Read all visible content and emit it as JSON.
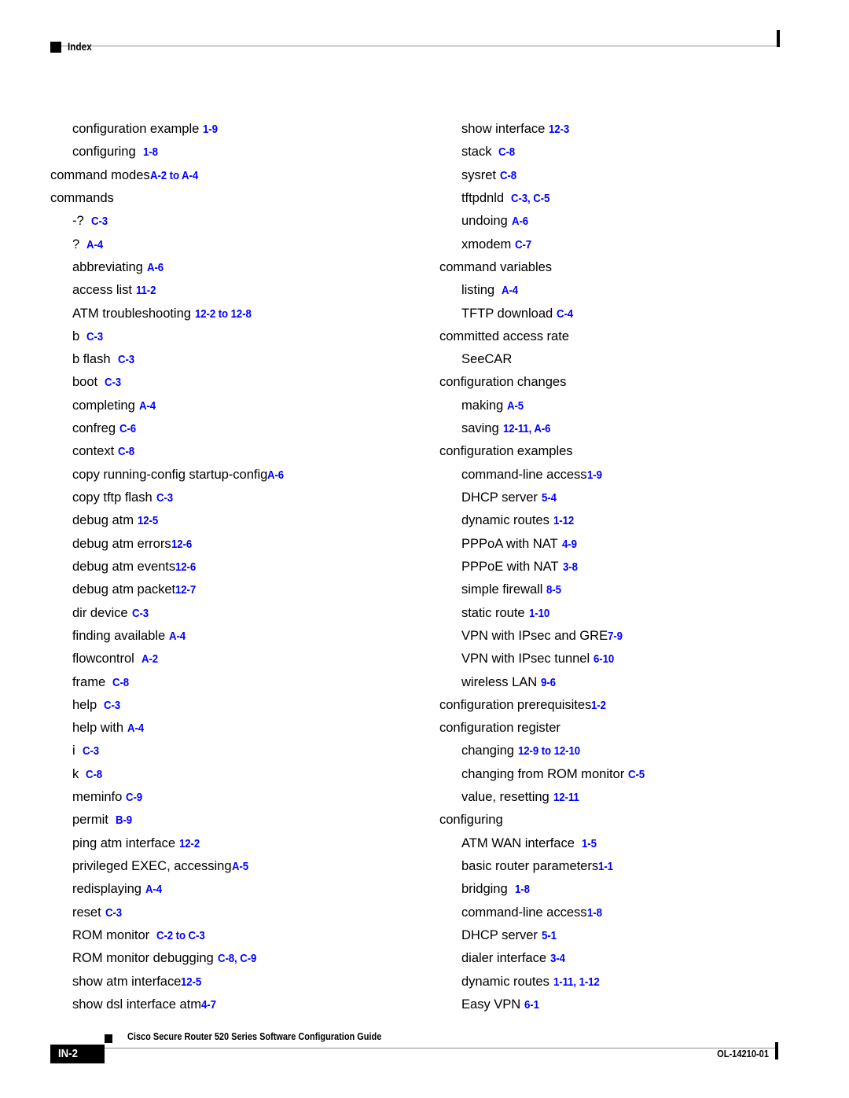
{
  "header": {
    "section_label": "Index"
  },
  "colors": {
    "locator_blue": "#0000FF",
    "rule_gray": "#8A8A8A",
    "text_black": "#000000"
  },
  "index": {
    "left_column": [
      {
        "level": 2,
        "term": "configuration example",
        "gap": "med",
        "locator": "1-9"
      },
      {
        "level": 2,
        "term": "configuring",
        "gap": "wide",
        "locator": "1-8"
      },
      {
        "level": 1,
        "term": "command modes",
        "gap": "none",
        "locator": "A-2 to A-4"
      },
      {
        "level": 1,
        "term": "commands",
        "gap": "none",
        "locator": ""
      },
      {
        "level": 2,
        "term": "-?",
        "gap": "wide",
        "locator": "C-3"
      },
      {
        "level": 2,
        "term": "?",
        "gap": "wide",
        "locator": "A-4"
      },
      {
        "level": 2,
        "term": "abbreviating",
        "gap": "med",
        "locator": "A-6"
      },
      {
        "level": 2,
        "term": "access list",
        "gap": "med",
        "locator": "11-2"
      },
      {
        "level": 2,
        "term": "ATM troubleshooting",
        "gap": "med",
        "locator": "12-2 to 12-8"
      },
      {
        "level": 2,
        "term": "b",
        "gap": "wide",
        "locator": "C-3"
      },
      {
        "level": 2,
        "term": "b flash",
        "gap": "wide",
        "locator": "C-3"
      },
      {
        "level": 2,
        "term": "boot",
        "gap": "wide",
        "locator": "C-3"
      },
      {
        "level": 2,
        "term": "completing",
        "gap": "med",
        "locator": "A-4"
      },
      {
        "level": 2,
        "term": "confreg",
        "gap": "med",
        "locator": "C-6"
      },
      {
        "level": 2,
        "term": "context",
        "gap": "med",
        "locator": "C-8"
      },
      {
        "level": 2,
        "term": "copy running-config startup-config",
        "gap": "none",
        "locator": "A-6"
      },
      {
        "level": 2,
        "term": "copy tftp flash",
        "gap": "med",
        "locator": "C-3"
      },
      {
        "level": 2,
        "term": "debug atm",
        "gap": "med",
        "locator": "12-5"
      },
      {
        "level": 2,
        "term": "debug atm errors",
        "gap": "none",
        "locator": "12-6"
      },
      {
        "level": 2,
        "term": "debug atm events",
        "gap": "none",
        "locator": "12-6"
      },
      {
        "level": 2,
        "term": "debug atm packet",
        "gap": "none",
        "locator": "12-7"
      },
      {
        "level": 2,
        "term": "dir device",
        "gap": "med",
        "locator": "C-3"
      },
      {
        "level": 2,
        "term": "finding available",
        "gap": "med",
        "locator": "A-4"
      },
      {
        "level": 2,
        "term": "flowcontrol",
        "gap": "wide",
        "locator": "A-2"
      },
      {
        "level": 2,
        "term": "frame",
        "gap": "wide",
        "locator": "C-8"
      },
      {
        "level": 2,
        "term": "help",
        "gap": "wide",
        "locator": "C-3"
      },
      {
        "level": 2,
        "term": "help with",
        "gap": "med",
        "locator": "A-4"
      },
      {
        "level": 2,
        "term": "i",
        "gap": "wide",
        "locator": "C-3"
      },
      {
        "level": 2,
        "term": "k",
        "gap": "wide",
        "locator": "C-8"
      },
      {
        "level": 2,
        "term": "meminfo",
        "gap": "med",
        "locator": "C-9"
      },
      {
        "level": 2,
        "term": "permit",
        "gap": "wide",
        "locator": "B-9"
      },
      {
        "level": 2,
        "term": "ping atm interface",
        "gap": "med",
        "locator": "12-2"
      },
      {
        "level": 2,
        "term": "privileged EXEC, accessing",
        "gap": "none",
        "locator": "A-5"
      },
      {
        "level": 2,
        "term": "redisplaying",
        "gap": "med",
        "locator": "A-4"
      },
      {
        "level": 2,
        "term": "reset",
        "gap": "med",
        "locator": "C-3"
      },
      {
        "level": 2,
        "term": "ROM monitor",
        "gap": "wide",
        "locator": "C-2 to C-3"
      },
      {
        "level": 2,
        "term": "ROM monitor debugging",
        "gap": "med",
        "locator": "C-8, C-9"
      },
      {
        "level": 2,
        "term": "show atm interface",
        "gap": "none",
        "locator": "12-5"
      },
      {
        "level": 2,
        "term": "show dsl interface atm",
        "gap": "none",
        "locator": "4-7"
      }
    ],
    "right_column": [
      {
        "level": 2,
        "term": "show interface",
        "gap": "med",
        "locator": "12-3"
      },
      {
        "level": 2,
        "term": "stack",
        "gap": "wide",
        "locator": "C-8"
      },
      {
        "level": 2,
        "term": "sysret",
        "gap": "med",
        "locator": "C-8"
      },
      {
        "level": 2,
        "term": "tftpdnld",
        "gap": "wide",
        "locator": "C-3, C-5"
      },
      {
        "level": 2,
        "term": "undoing",
        "gap": "med",
        "locator": "A-6"
      },
      {
        "level": 2,
        "term": "xmodem",
        "gap": "med",
        "locator": "C-7"
      },
      {
        "level": 1,
        "term": "command variables",
        "gap": "none",
        "locator": ""
      },
      {
        "level": 2,
        "term": "listing",
        "gap": "wide",
        "locator": "A-4"
      },
      {
        "level": 2,
        "term": "TFTP download",
        "gap": "med",
        "locator": "C-4"
      },
      {
        "level": 1,
        "term": "committed access rate",
        "gap": "none",
        "locator": ""
      },
      {
        "level": 2,
        "term": "SeeCAR",
        "gap": "none",
        "locator": ""
      },
      {
        "level": 1,
        "term": "configuration changes",
        "gap": "none",
        "locator": ""
      },
      {
        "level": 2,
        "term": "making",
        "gap": "med",
        "locator": "A-5"
      },
      {
        "level": 2,
        "term": "saving",
        "gap": "med",
        "locator": "12-11, A-6"
      },
      {
        "level": 1,
        "term": "configuration examples",
        "gap": "none",
        "locator": ""
      },
      {
        "level": 2,
        "term": "command-line access",
        "gap": "none",
        "locator": "1-9"
      },
      {
        "level": 2,
        "term": "DHCP server",
        "gap": "med",
        "locator": "5-4"
      },
      {
        "level": 2,
        "term": "dynamic routes",
        "gap": "med",
        "locator": "1-12"
      },
      {
        "level": 2,
        "term": "PPPoA with NAT",
        "gap": "med",
        "locator": "4-9"
      },
      {
        "level": 2,
        "term": "PPPoE with NAT",
        "gap": "med",
        "locator": "3-8"
      },
      {
        "level": 2,
        "term": "simple firewall",
        "gap": "med",
        "locator": "8-5"
      },
      {
        "level": 2,
        "term": "static route",
        "gap": "med",
        "locator": "1-10"
      },
      {
        "level": 2,
        "term": "VPN with IPsec and GRE",
        "gap": "none",
        "locator": "7-9"
      },
      {
        "level": 2,
        "term": "VPN with IPsec tunnel",
        "gap": "med",
        "locator": "6-10"
      },
      {
        "level": 2,
        "term": "wireless LAN",
        "gap": "med",
        "locator": "9-6"
      },
      {
        "level": 1,
        "term": "configuration prerequisites",
        "gap": "none",
        "locator": "1-2"
      },
      {
        "level": 1,
        "term": "configuration register",
        "gap": "none",
        "locator": ""
      },
      {
        "level": 2,
        "term": "changing",
        "gap": "med",
        "locator": "12-9 to 12-10"
      },
      {
        "level": 2,
        "term": "changing from ROM monitor",
        "gap": "med",
        "locator": "C-5"
      },
      {
        "level": 2,
        "term": "value, resetting",
        "gap": "med",
        "locator": "12-11"
      },
      {
        "level": 1,
        "term": "configuring",
        "gap": "none",
        "locator": ""
      },
      {
        "level": 2,
        "term": "ATM WAN interface",
        "gap": "wide",
        "locator": "1-5"
      },
      {
        "level": 2,
        "term": "basic router parameters",
        "gap": "none",
        "locator": "1-1"
      },
      {
        "level": 2,
        "term": "bridging",
        "gap": "wide",
        "locator": "1-8"
      },
      {
        "level": 2,
        "term": "command-line access",
        "gap": "none",
        "locator": "1-8"
      },
      {
        "level": 2,
        "term": "DHCP server",
        "gap": "med",
        "locator": "5-1"
      },
      {
        "level": 2,
        "term": "dialer interface",
        "gap": "med",
        "locator": "3-4"
      },
      {
        "level": 2,
        "term": "dynamic routes",
        "gap": "med",
        "locator": "1-11, 1-12"
      },
      {
        "level": 2,
        "term": "Easy VPN",
        "gap": "med",
        "locator": "6-1"
      }
    ]
  },
  "footer": {
    "page_number": "IN-2",
    "document_title": "Cisco Secure Router 520 Series Software Configuration Guide",
    "document_id": "OL-14210-01"
  }
}
